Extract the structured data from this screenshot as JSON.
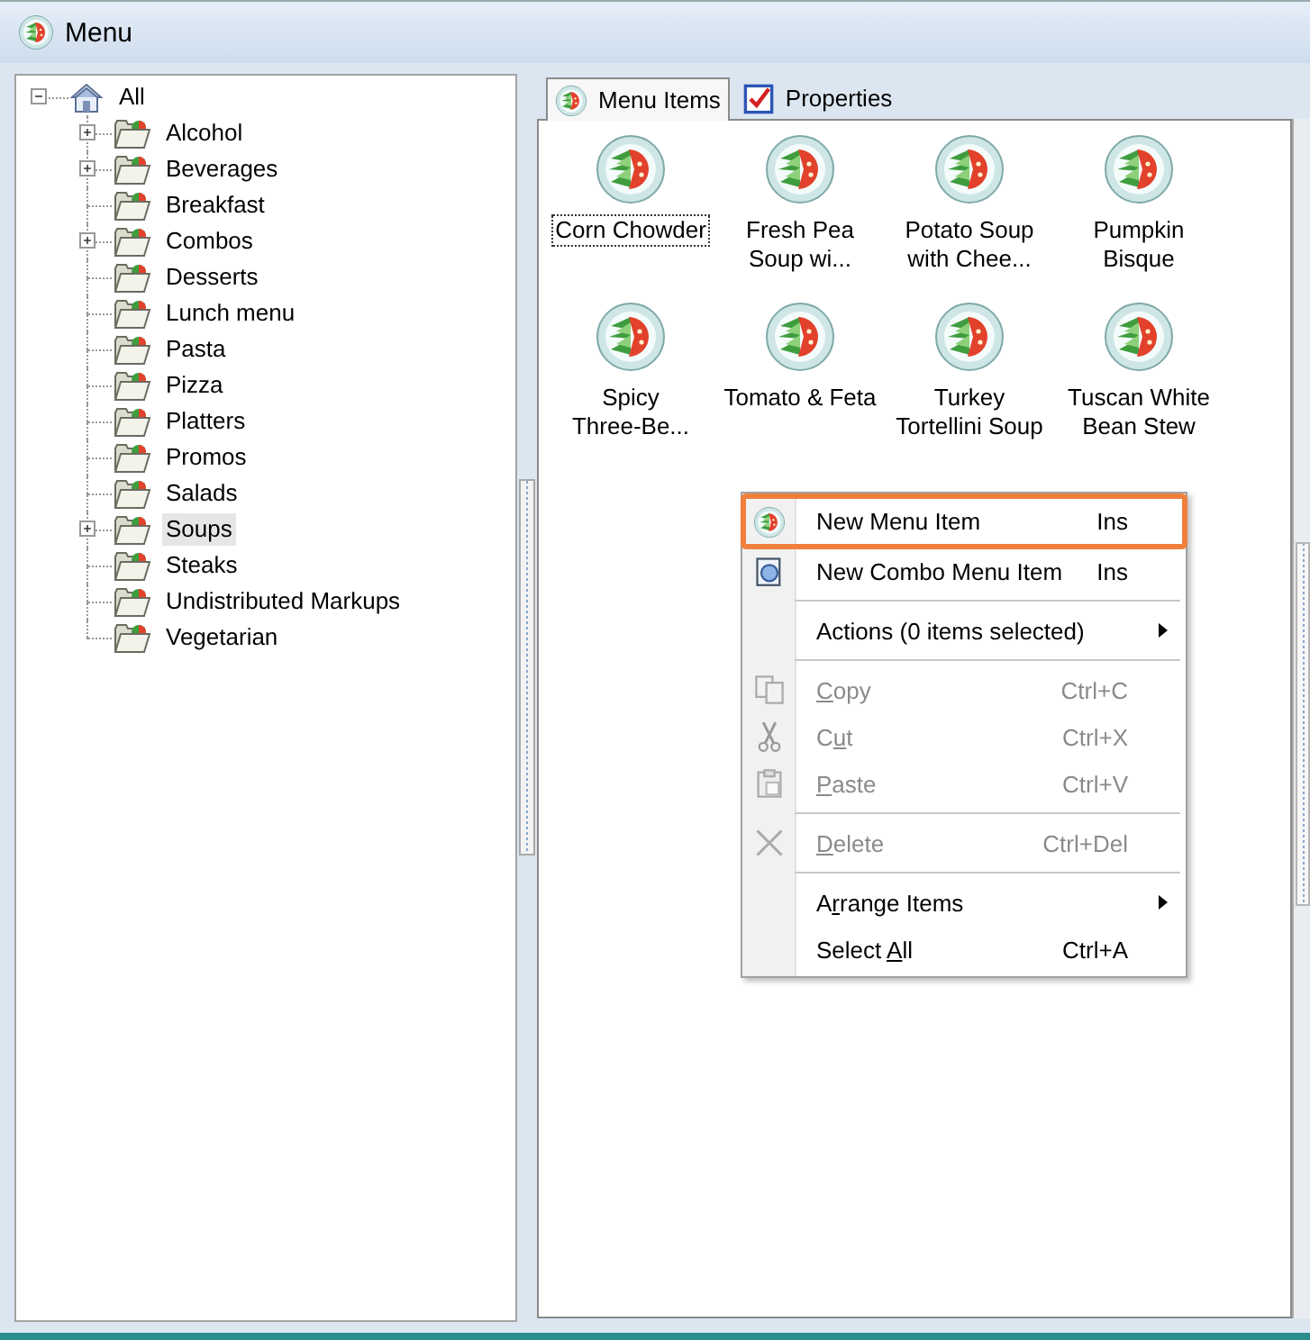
{
  "window": {
    "title": "Menu"
  },
  "tree": {
    "label": "All",
    "expanded": true,
    "children": [
      {
        "label": "Alcohol",
        "expandable": true,
        "selected": false
      },
      {
        "label": "Beverages",
        "expandable": true,
        "selected": false
      },
      {
        "label": "Breakfast",
        "expandable": false,
        "selected": false
      },
      {
        "label": "Combos",
        "expandable": true,
        "selected": false
      },
      {
        "label": "Desserts",
        "expandable": false,
        "selected": false
      },
      {
        "label": "Lunch menu",
        "expandable": false,
        "selected": false
      },
      {
        "label": "Pasta",
        "expandable": false,
        "selected": false
      },
      {
        "label": "Pizza",
        "expandable": false,
        "selected": false
      },
      {
        "label": "Platters",
        "expandable": false,
        "selected": false
      },
      {
        "label": "Promos",
        "expandable": false,
        "selected": false
      },
      {
        "label": "Salads",
        "expandable": false,
        "selected": false
      },
      {
        "label": "Soups",
        "expandable": true,
        "selected": true
      },
      {
        "label": "Steaks",
        "expandable": false,
        "selected": false
      },
      {
        "label": "Undistributed Markups",
        "expandable": false,
        "selected": false
      },
      {
        "label": "Vegetarian",
        "expandable": false,
        "selected": false
      }
    ]
  },
  "tabs": [
    {
      "label": "Menu Items",
      "selected": true
    },
    {
      "label": "Properties",
      "selected": false
    }
  ],
  "menu_items": [
    {
      "lines": [
        "Corn Chowder"
      ],
      "focused": true
    },
    {
      "lines": [
        "Fresh Pea",
        "Soup wi..."
      ],
      "focused": false
    },
    {
      "lines": [
        "Potato Soup",
        "with Chee..."
      ],
      "focused": false
    },
    {
      "lines": [
        "Pumpkin",
        "Bisque"
      ],
      "focused": false
    },
    {
      "lines": [
        "Spicy",
        "Three-Be..."
      ],
      "focused": false
    },
    {
      "lines": [
        "Tomato & Feta"
      ],
      "focused": false
    },
    {
      "lines": [
        "Turkey",
        "Tortellini Soup"
      ],
      "focused": false
    },
    {
      "lines": [
        "Tuscan White",
        "Bean Stew"
      ],
      "focused": false
    }
  ],
  "context_menu": {
    "groups": [
      [
        {
          "label_pre": "New Menu Item",
          "shortcut": "Ins",
          "disabled": false,
          "highlighted": true,
          "submenu": false
        },
        {
          "label_pre": "New Combo Menu Item",
          "shortcut": "Ins",
          "disabled": false,
          "highlighted": false,
          "submenu": false
        }
      ],
      [
        {
          "label_pre": "Actions (0 items selected)",
          "disabled": false,
          "highlighted": false,
          "submenu": true
        }
      ],
      [
        {
          "access_key": "C",
          "label_post": "opy",
          "shortcut": "Ctrl+C",
          "disabled": true,
          "highlighted": false,
          "submenu": false
        },
        {
          "label_pre": "C",
          "access_key": "u",
          "label_post": "t",
          "shortcut": "Ctrl+X",
          "disabled": true,
          "highlighted": false,
          "submenu": false
        },
        {
          "access_key": "P",
          "label_post": "aste",
          "shortcut": "Ctrl+V",
          "disabled": true,
          "highlighted": false,
          "submenu": false
        }
      ],
      [
        {
          "access_key": "D",
          "label_post": "elete",
          "shortcut": "Ctrl+Del",
          "disabled": true,
          "highlighted": false,
          "submenu": false
        }
      ],
      [
        {
          "label_pre": "A",
          "access_key": "r",
          "label_post": "range Items",
          "disabled": false,
          "highlighted": false,
          "submenu": true
        },
        {
          "label_pre": "Select ",
          "access_key": "A",
          "label_post": "ll",
          "shortcut": "Ctrl+A",
          "disabled": false,
          "highlighted": false,
          "submenu": false
        }
      ]
    ]
  }
}
